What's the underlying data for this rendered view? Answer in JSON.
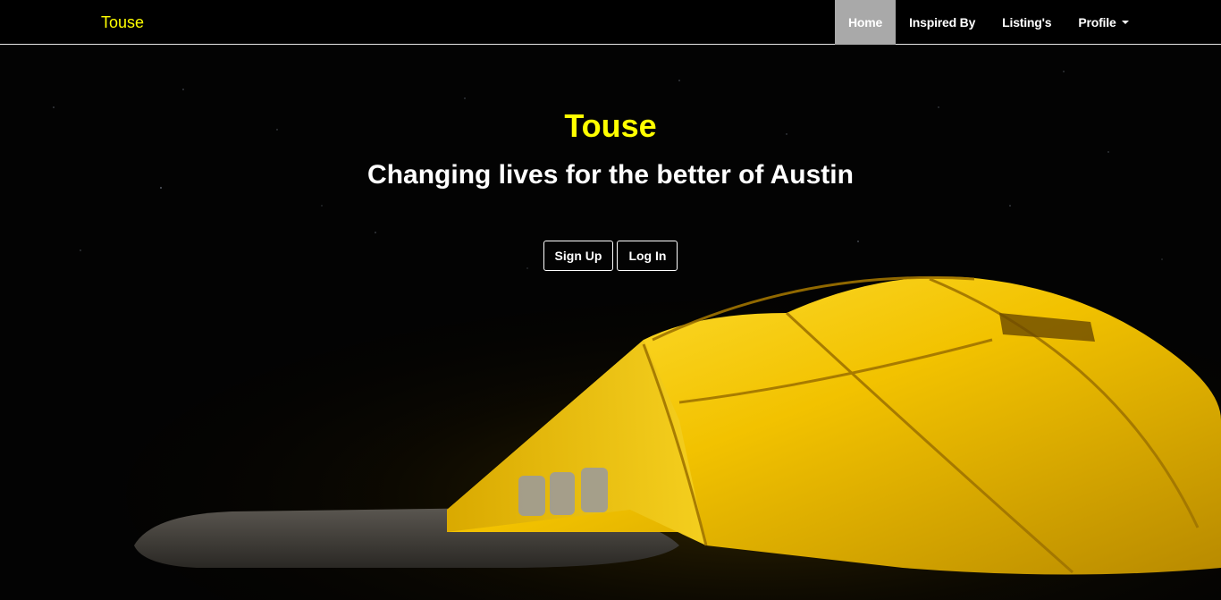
{
  "nav": {
    "brand": "Touse",
    "items": [
      {
        "label": "Home",
        "active": true
      },
      {
        "label": "Inspired By",
        "active": false
      },
      {
        "label": "Listing's",
        "active": false
      },
      {
        "label": "Profile",
        "active": false,
        "dropdown": true
      }
    ]
  },
  "hero": {
    "title": "Touse",
    "subtitle": "Changing lives for the better of Austin",
    "buttons": {
      "signup": "Sign Up",
      "login": "Log In"
    },
    "background": "night-camping-tent-image"
  },
  "colors": {
    "brand": "#ffff00",
    "nav_bg": "#000000",
    "active_bg": "#a9a9a9",
    "text": "#ffffff",
    "tent": "#f2c200"
  }
}
